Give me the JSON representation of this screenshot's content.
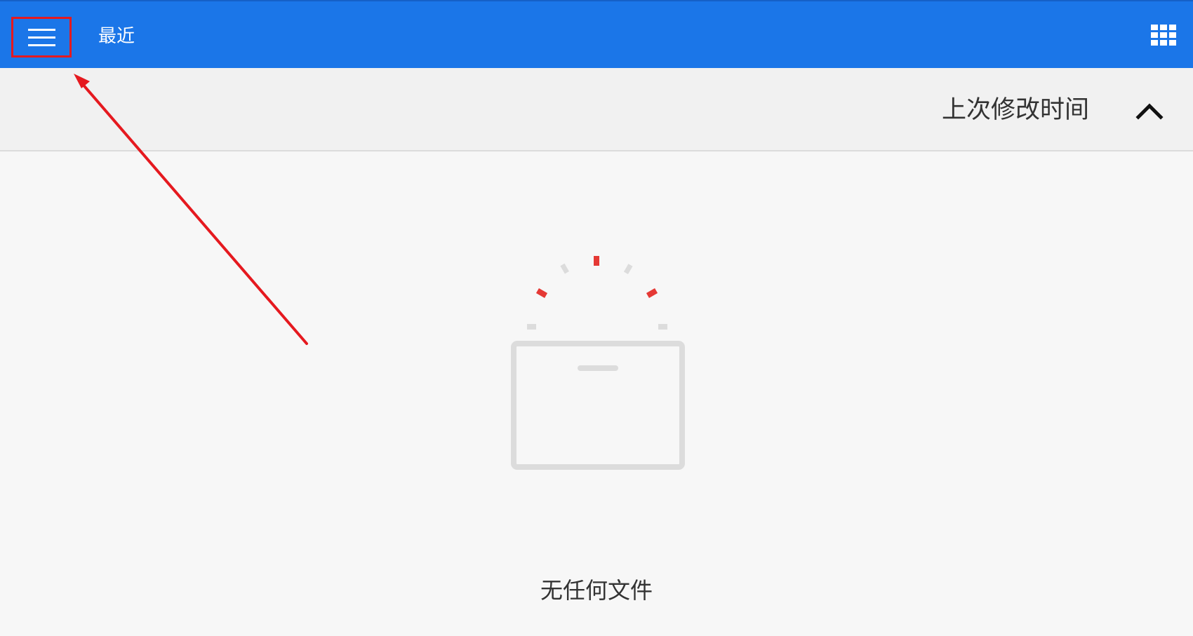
{
  "header": {
    "title": "最近",
    "menu_icon": "hamburger-menu-icon",
    "view_icon": "grid-view-icon",
    "background_color": "#1b76e8"
  },
  "sort_bar": {
    "label": "上次修改时间",
    "toggle_icon": "chevron-up-icon"
  },
  "empty_state": {
    "message": "无任何文件",
    "illustration_icon": "empty-folder-icon",
    "accent_color": "#e53935"
  },
  "annotation": {
    "highlight_color": "#e5191f"
  }
}
